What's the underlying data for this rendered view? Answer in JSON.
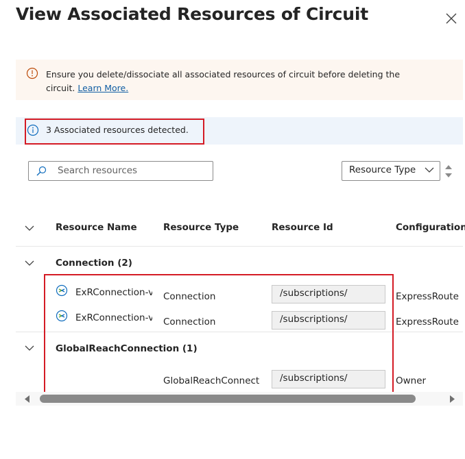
{
  "dialog": {
    "title": "View Associated Resources of Circuit"
  },
  "warning": {
    "text": "Ensure you delete/dissociate all associated resources of circuit before deleting the circuit.",
    "link": "Learn More."
  },
  "info": {
    "text": "3 Associated resources detected."
  },
  "toolbar": {
    "search_placeholder": "Search resources",
    "filter_label": "Resource Type"
  },
  "table": {
    "columns": [
      "Resource Name",
      "Resource Type",
      "Resource Id",
      "Configuration"
    ],
    "groups": [
      {
        "title": "Connection (2)",
        "rows": [
          {
            "name": "ExRConnection-v",
            "type": "Connection",
            "id": "/subscriptions/",
            "config": "ExpressRoute"
          },
          {
            "name": "ExRConnection-v",
            "type": "Connection",
            "id": "/subscriptions/",
            "config": "ExpressRoute"
          }
        ]
      },
      {
        "title": "GlobalReachConnection (1)",
        "rows": [
          {
            "name": "",
            "type": "GlobalReachConnect",
            "id": "/subscriptions/",
            "config": "Owner"
          }
        ]
      }
    ]
  },
  "colors": {
    "highlight": "#d41a24",
    "link": "#115ea3",
    "warning_bg": "#fdf6f0",
    "info_bg": "#eef4fb"
  }
}
